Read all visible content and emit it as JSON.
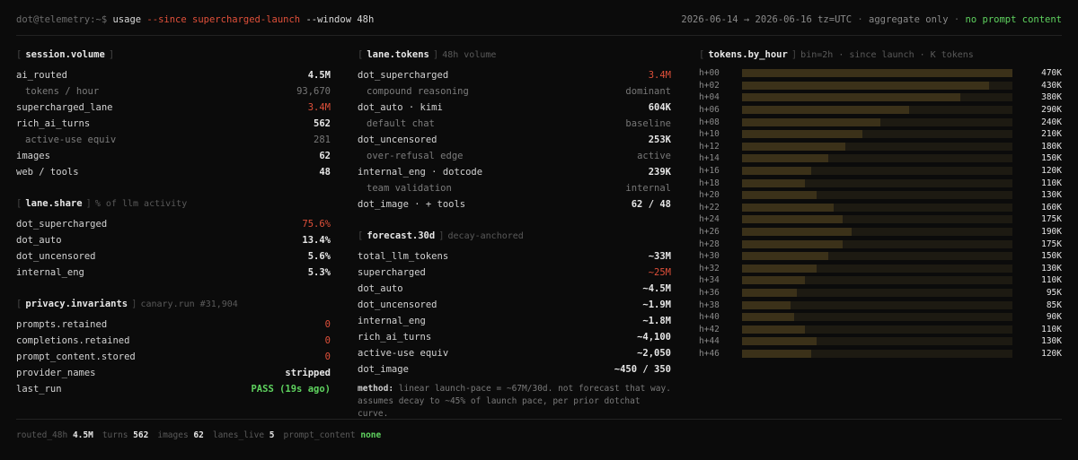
{
  "command": {
    "prompt": "dot@telemetry:~$",
    "cmd": "usage",
    "flag_since": "--since",
    "since_value": "supercharged-launch",
    "flag_window": "--window",
    "window_value": "48h"
  },
  "status": {
    "range": "2026-06-14 → 2026-06-16",
    "tz": "tz=UTC",
    "sep1": "·",
    "mode": "aggregate only",
    "sep2": "·",
    "privacy": "no prompt content"
  },
  "session_volume": {
    "title": "session.volume",
    "rows": [
      {
        "label": "ai_routed",
        "value": "4.5M",
        "sub": false
      },
      {
        "label": "tokens / hour",
        "value": "93,670",
        "sub": true
      },
      {
        "label": "supercharged_lane",
        "value": "3.4M",
        "sub": false,
        "color": "red"
      },
      {
        "label": "rich_ai_turns",
        "value": "562",
        "sub": false
      },
      {
        "label": "active-use equiv",
        "value": "281",
        "sub": true
      },
      {
        "label": "images",
        "value": "62",
        "sub": false
      },
      {
        "label": "web / tools",
        "value": "48",
        "sub": false
      }
    ]
  },
  "lane_share": {
    "title": "lane.share",
    "subtitle": "% of llm activity",
    "rows": [
      {
        "label": "dot_supercharged",
        "value": "75.6%",
        "color": "red"
      },
      {
        "label": "dot_auto",
        "value": "13.4%"
      },
      {
        "label": "dot_uncensored",
        "value": "5.6%"
      },
      {
        "label": "internal_eng",
        "value": "5.3%"
      }
    ]
  },
  "privacy_invariants": {
    "title": "privacy.invariants",
    "subtitle": "canary.run #31,904",
    "rows": [
      {
        "label": "prompts.retained",
        "value": "0",
        "color": "red"
      },
      {
        "label": "completions.retained",
        "value": "0",
        "color": "red"
      },
      {
        "label": "prompt_content.stored",
        "value": "0",
        "color": "red"
      },
      {
        "label": "provider_names",
        "value": "stripped"
      },
      {
        "label": "last_run",
        "value": "PASS (19s ago)",
        "color": "green"
      }
    ]
  },
  "lane_tokens": {
    "title": "lane.tokens",
    "subtitle": "48h volume",
    "rows": [
      {
        "label": "dot_supercharged",
        "value": "3.4M",
        "sub": false,
        "color": "red"
      },
      {
        "label": "compound reasoning",
        "value": "dominant",
        "sub": true
      },
      {
        "label": "dot_auto · kimi",
        "value": "604K",
        "sub": false
      },
      {
        "label": "default chat",
        "value": "baseline",
        "sub": true
      },
      {
        "label": "dot_uncensored",
        "value": "253K",
        "sub": false
      },
      {
        "label": "over-refusal edge",
        "value": "active",
        "sub": true
      },
      {
        "label": "internal_eng · dotcode",
        "value": "239K",
        "sub": false
      },
      {
        "label": "team validation",
        "value": "internal",
        "sub": true
      },
      {
        "label": "dot_image · + tools",
        "value": "62 / 48",
        "sub": false
      }
    ]
  },
  "forecast": {
    "title": "forecast.30d",
    "subtitle": "decay-anchored",
    "rows": [
      {
        "label": "total_llm_tokens",
        "value": "~33M"
      },
      {
        "label": "supercharged",
        "value": "~25M",
        "color": "red"
      },
      {
        "label": "dot_auto",
        "value": "~4.5M"
      },
      {
        "label": "dot_uncensored",
        "value": "~1.9M"
      },
      {
        "label": "internal_eng",
        "value": "~1.8M"
      },
      {
        "label": "rich_ai_turns",
        "value": "~4,100"
      },
      {
        "label": "active-use equiv",
        "value": "~2,050"
      },
      {
        "label": "dot_image",
        "value": "~450 / 350"
      }
    ],
    "method_key": "method:",
    "method_text": "linear launch-pace = ~67M/30d. not forecast that way. assumes decay to ~45% of launch pace, per prior dotchat curve."
  },
  "tokens_by_hour": {
    "title": "tokens.by_hour",
    "subtitle": "bin=2h · since launch · K tokens",
    "max": 470,
    "rows": [
      {
        "hour": "h+00",
        "value": 470,
        "label": "470K"
      },
      {
        "hour": "h+02",
        "value": 430,
        "label": "430K"
      },
      {
        "hour": "h+04",
        "value": 380,
        "label": "380K"
      },
      {
        "hour": "h+06",
        "value": 290,
        "label": "290K"
      },
      {
        "hour": "h+08",
        "value": 240,
        "label": "240K"
      },
      {
        "hour": "h+10",
        "value": 210,
        "label": "210K"
      },
      {
        "hour": "h+12",
        "value": 180,
        "label": "180K"
      },
      {
        "hour": "h+14",
        "value": 150,
        "label": "150K"
      },
      {
        "hour": "h+16",
        "value": 120,
        "label": "120K"
      },
      {
        "hour": "h+18",
        "value": 110,
        "label": "110K"
      },
      {
        "hour": "h+20",
        "value": 130,
        "label": "130K"
      },
      {
        "hour": "h+22",
        "value": 160,
        "label": "160K"
      },
      {
        "hour": "h+24",
        "value": 175,
        "label": "175K"
      },
      {
        "hour": "h+26",
        "value": 190,
        "label": "190K"
      },
      {
        "hour": "h+28",
        "value": 175,
        "label": "175K"
      },
      {
        "hour": "h+30",
        "value": 150,
        "label": "150K"
      },
      {
        "hour": "h+32",
        "value": 130,
        "label": "130K"
      },
      {
        "hour": "h+34",
        "value": 110,
        "label": "110K"
      },
      {
        "hour": "h+36",
        "value": 95,
        "label": "95K"
      },
      {
        "hour": "h+38",
        "value": 85,
        "label": "85K"
      },
      {
        "hour": "h+40",
        "value": 90,
        "label": "90K"
      },
      {
        "hour": "h+42",
        "value": 110,
        "label": "110K"
      },
      {
        "hour": "h+44",
        "value": 130,
        "label": "130K"
      },
      {
        "hour": "h+46",
        "value": 120,
        "label": "120K"
      }
    ]
  },
  "footer": [
    {
      "key": "routed_48h",
      "value": "4.5M"
    },
    {
      "key": "turns",
      "value": "562"
    },
    {
      "key": "images",
      "value": "62"
    },
    {
      "key": "lanes_live",
      "value": "5"
    },
    {
      "key": "prompt_content",
      "value": "none",
      "color": "green"
    }
  ],
  "colors": {
    "background": "#0b0b0b",
    "accent_red": "#e0503a",
    "accent_green": "#5fd35f",
    "bar_track": "#1d1a12",
    "bar_fill": "#3b3119"
  }
}
